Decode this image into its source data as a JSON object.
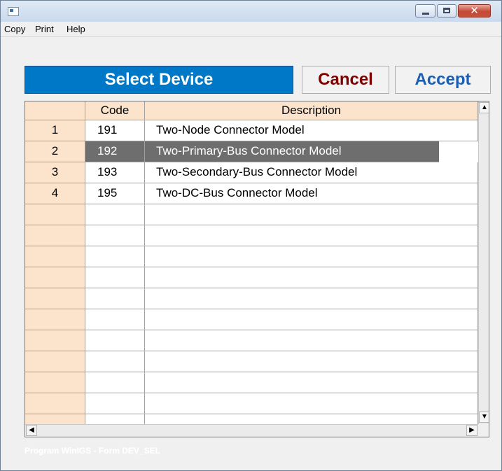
{
  "window": {
    "controls": {
      "minimize_icon": "minimize-icon",
      "maximize_icon": "maximize-icon",
      "close_glyph": "✕"
    }
  },
  "menu": [
    "Copy",
    "Print",
    "Help"
  ],
  "header_buttons": {
    "title": "Select Device",
    "cancel": "Cancel",
    "accept": "Accept",
    "colors": {
      "title_bg": "#0078c8",
      "cancel_text": "#800000",
      "accept_text": "#1a5fb4"
    }
  },
  "grid": {
    "columns": [
      "",
      "Code",
      "Description"
    ],
    "rows": [
      {
        "num": "1",
        "code": "191",
        "desc": "Two-Node Connector Model",
        "selected": false
      },
      {
        "num": "2",
        "code": "192",
        "desc": "Two-Primary-Bus Connector Model",
        "selected": true
      },
      {
        "num": "3",
        "code": "193",
        "desc": "Two-Secondary-Bus Connector Model",
        "selected": false
      },
      {
        "num": "4",
        "code": "195",
        "desc": "Two-DC-Bus Connector Model",
        "selected": false
      }
    ],
    "colors": {
      "header_bg": "#fce4cc",
      "selected_bg": "#6e6e6e"
    },
    "scroll_glyphs": {
      "up": "▲",
      "down": "▼",
      "left": "◀",
      "right": "▶"
    }
  },
  "footer": "Program WinIGS - Form DEV_SEL"
}
